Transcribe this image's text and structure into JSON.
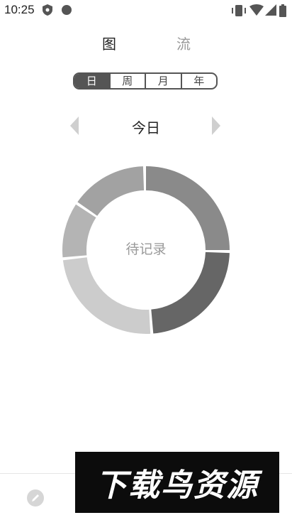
{
  "status_bar": {
    "time": "10:25"
  },
  "nav_tabs": [
    {
      "label": "图",
      "active": true
    },
    {
      "label": "流",
      "active": false
    }
  ],
  "period_segments": [
    {
      "label": "日",
      "active": true
    },
    {
      "label": "周",
      "active": false
    },
    {
      "label": "月",
      "active": false
    },
    {
      "label": "年",
      "active": false
    }
  ],
  "date_nav": {
    "label": "今日"
  },
  "donut": {
    "center_label": "待记录",
    "segments": [
      {
        "start": 0,
        "end": 90,
        "color": "#8a8a8a"
      },
      {
        "start": 92,
        "end": 175,
        "color": "#666666"
      },
      {
        "start": 177,
        "end": 263,
        "color": "#cccccc"
      },
      {
        "start": 265,
        "end": 303,
        "color": "#b4b4b4"
      },
      {
        "start": 305,
        "end": 358,
        "color": "#a2a2a2"
      }
    ]
  },
  "banner": {
    "text": "下载鸟资源"
  },
  "icons": {
    "edit": "pencil-icon"
  }
}
